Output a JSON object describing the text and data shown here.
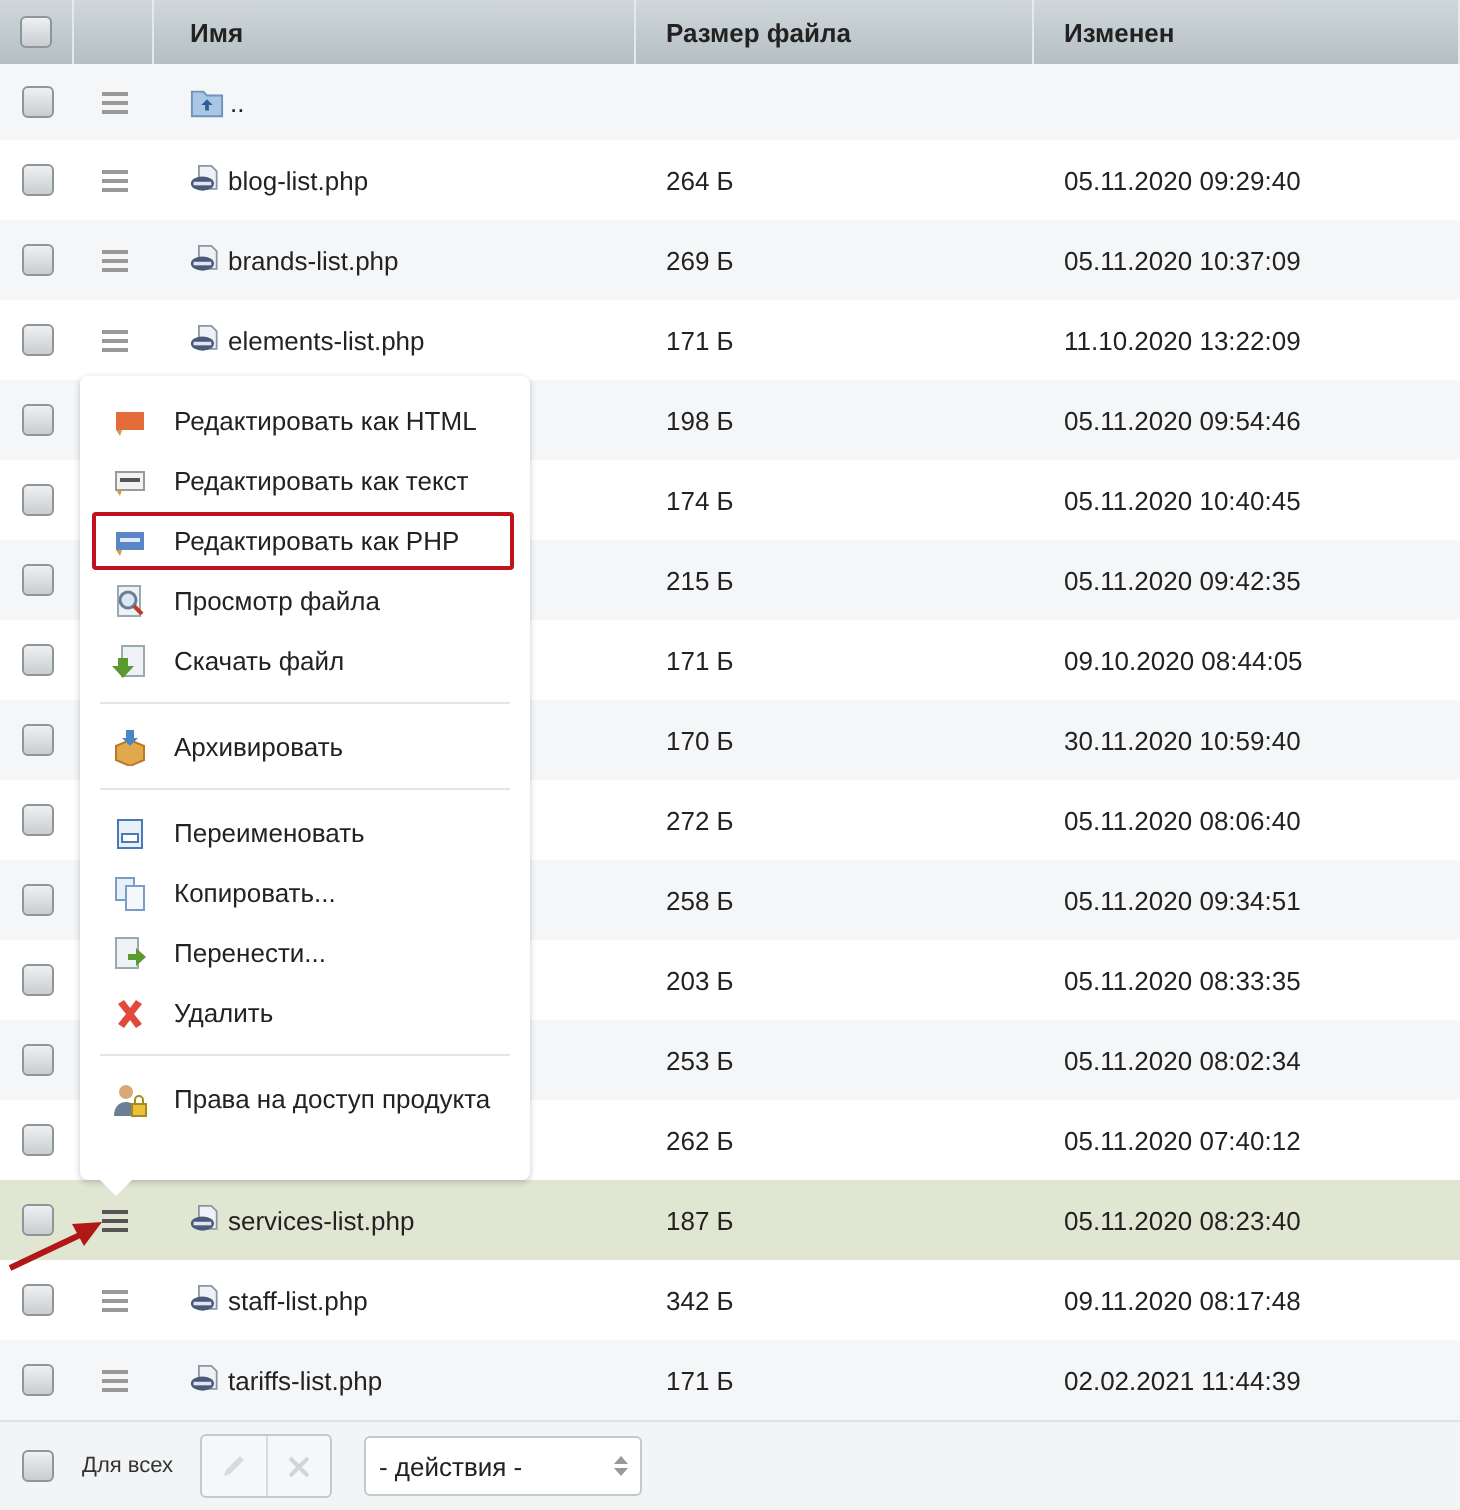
{
  "table": {
    "all_checked": false,
    "columns": [
      "Имя",
      "Размер файла",
      "Изменен"
    ],
    "rows": [
      {
        "kind": "parent",
        "name": "..",
        "checked": false,
        "selected": false
      },
      {
        "kind": "file",
        "name": "blog-list.php",
        "size": "264 Б",
        "modified": "05.11.2020 09:29:40",
        "checked": false,
        "selected": false
      },
      {
        "kind": "file",
        "name": "brands-list.php",
        "size": "269 Б",
        "modified": "05.11.2020 10:37:09",
        "checked": false,
        "selected": false
      },
      {
        "kind": "file",
        "name": "elements-list.php",
        "size": "171 Б",
        "modified": "11.10.2020 13:22:09",
        "checked": false,
        "selected": false
      },
      {
        "kind": "covered",
        "size": "198 Б",
        "modified": "05.11.2020 09:54:46",
        "checked": false,
        "selected": false
      },
      {
        "kind": "covered",
        "size": "174 Б",
        "modified": "05.11.2020 10:40:45",
        "checked": false,
        "selected": false
      },
      {
        "kind": "covered",
        "size": "215 Б",
        "modified": "05.11.2020 09:42:35",
        "checked": false,
        "selected": false
      },
      {
        "kind": "covered",
        "size": "171 Б",
        "modified": "09.10.2020 08:44:05",
        "checked": false,
        "selected": false
      },
      {
        "kind": "covered",
        "size": "170 Б",
        "modified": "30.11.2020 10:59:40",
        "checked": false,
        "selected": false
      },
      {
        "kind": "covered",
        "size": "272 Б",
        "modified": "05.11.2020 08:06:40",
        "checked": false,
        "selected": false
      },
      {
        "kind": "covered",
        "size": "258 Б",
        "modified": "05.11.2020 09:34:51",
        "checked": false,
        "selected": false
      },
      {
        "kind": "covered",
        "size": "203 Б",
        "modified": "05.11.2020 08:33:35",
        "checked": false,
        "selected": false
      },
      {
        "kind": "covered",
        "size": "253 Б",
        "modified": "05.11.2020 08:02:34",
        "checked": false,
        "selected": false
      },
      {
        "kind": "covered",
        "size": "262 Б",
        "modified": "05.11.2020 07:40:12",
        "checked": false,
        "selected": false
      },
      {
        "kind": "file",
        "name": "services-list.php",
        "size": "187 Б",
        "modified": "05.11.2020 08:23:40",
        "checked": false,
        "selected": true
      },
      {
        "kind": "file",
        "name": "staff-list.php",
        "size": "342 Б",
        "modified": "09.11.2020 08:17:48",
        "checked": false,
        "selected": false
      },
      {
        "kind": "file",
        "name": "tariffs-list.php",
        "size": "171 Б",
        "modified": "02.02.2021 11:44:39",
        "checked": false,
        "selected": false
      }
    ]
  },
  "context_menu": {
    "groups": [
      [
        {
          "kind": "html",
          "label": "Редактировать как HTML",
          "highlighted": false
        },
        {
          "kind": "text",
          "label": "Редактировать как текст",
          "highlighted": false
        },
        {
          "kind": "php",
          "label": "Редактировать как PHP",
          "highlighted": true
        },
        {
          "kind": "view",
          "label": "Просмотр файла",
          "highlighted": false
        },
        {
          "kind": "download",
          "label": "Скачать файл",
          "highlighted": false
        }
      ],
      [
        {
          "kind": "archive",
          "label": "Архивировать",
          "highlighted": false
        }
      ],
      [
        {
          "kind": "rename",
          "label": "Переименовать",
          "highlighted": false
        },
        {
          "kind": "copy",
          "label": "Копировать...",
          "highlighted": false
        },
        {
          "kind": "move",
          "label": "Перенести...",
          "highlighted": false
        },
        {
          "kind": "delete",
          "label": "Удалить",
          "highlighted": false
        }
      ],
      [
        {
          "kind": "access",
          "label": "Права на доступ продукта",
          "highlighted": false
        }
      ]
    ]
  },
  "footer": {
    "select_all": {
      "label": "Для всех",
      "checked": false
    },
    "edit_disabled": true,
    "delete_disabled": true,
    "actions": {
      "value": "- действия -"
    }
  }
}
